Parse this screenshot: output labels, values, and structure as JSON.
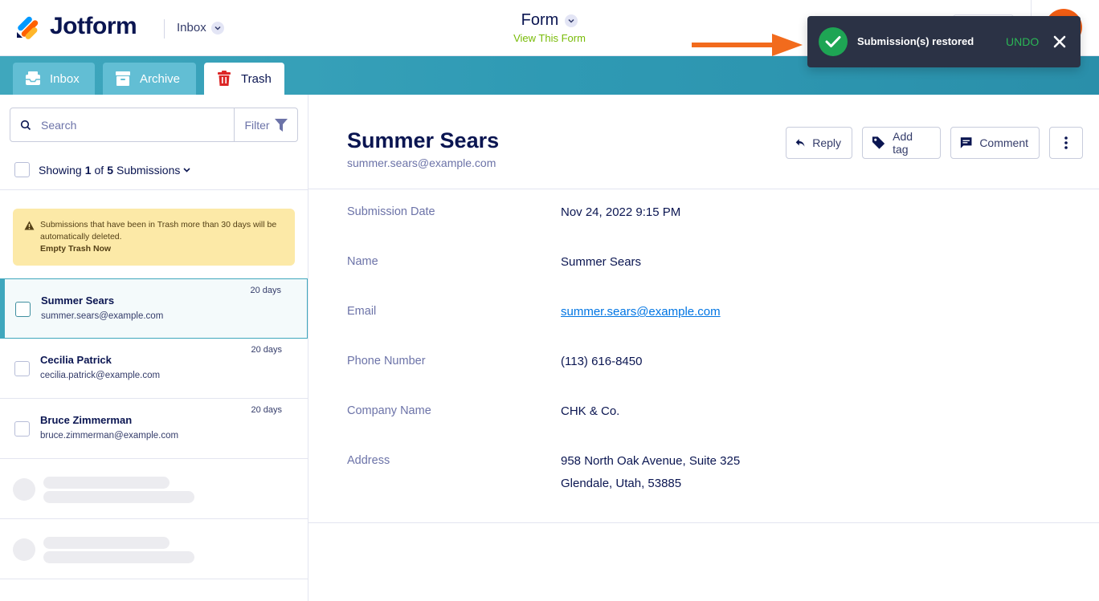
{
  "header": {
    "logo_text": "Jotform",
    "inbox_dropdown": "Inbox",
    "form_title": "Form",
    "view_form_link": "View This Form"
  },
  "tabs": [
    {
      "label": "Inbox",
      "icon": "inbox-icon",
      "active": false
    },
    {
      "label": "Archive",
      "icon": "archive-icon",
      "active": false
    },
    {
      "label": "Trash",
      "icon": "trash-icon",
      "active": true
    }
  ],
  "search": {
    "placeholder": "Search",
    "filter_label": "Filter"
  },
  "showing": {
    "prefix": "Showing",
    "current": "1",
    "of": "of",
    "total": "5",
    "suffix": "Submissions"
  },
  "warning": {
    "text": "Submissions that have been in Trash more than 30 days will be automatically deleted.",
    "link": "Empty Trash Now"
  },
  "submissions": [
    {
      "name": "Summer Sears",
      "email": "summer.sears@example.com",
      "age": "20 days",
      "selected": true
    },
    {
      "name": "Cecilia Patrick",
      "email": "cecilia.patrick@example.com",
      "age": "20 days",
      "selected": false
    },
    {
      "name": "Bruce Zimmerman",
      "email": "bruce.zimmerman@example.com",
      "age": "20 days",
      "selected": false
    }
  ],
  "detail": {
    "name": "Summer Sears",
    "email": "summer.sears@example.com",
    "actions": {
      "reply": "Reply",
      "add_tag": "Add tag",
      "comment": "Comment"
    },
    "fields": [
      {
        "label": "Submission Date",
        "value": "Nov 24, 2022 9:15 PM"
      },
      {
        "label": "Name",
        "value": "Summer Sears"
      },
      {
        "label": "Email",
        "value": "summer.sears@example.com"
      },
      {
        "label": "Phone Number",
        "value": "(113) 616-8450"
      },
      {
        "label": "Company Name",
        "value": "CHK & Co."
      },
      {
        "label": "Address",
        "value": "958 North Oak Avenue, Suite 325",
        "value2": "Glendale, Utah, 53885"
      }
    ]
  },
  "toast": {
    "message": "Submission(s) restored",
    "undo": "UNDO"
  },
  "colors": {
    "brand_navy": "#0a1551",
    "tab_teal": "#3fa7bd",
    "toast_bg": "#2b3245",
    "success_green": "#1ea554",
    "arrow_orange": "#f26b1d",
    "trash_red": "#dc2626",
    "link_blue": "#0075e3"
  }
}
